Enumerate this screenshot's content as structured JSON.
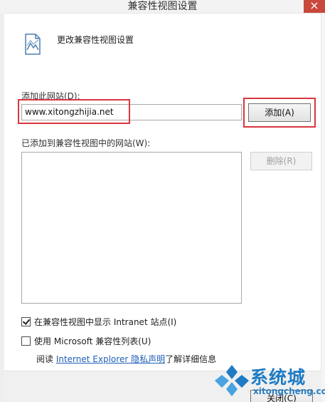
{
  "window": {
    "title": "兼容性视图设置",
    "close_glyph": "×"
  },
  "header": {
    "icon": "compatibility-page-icon",
    "text": "更改兼容性视图设置"
  },
  "add_site": {
    "label": "添加此网站(D):",
    "value": "www.xitongzhijia.net",
    "button_label": "添加(A)"
  },
  "added_sites": {
    "label": "已添加到兼容性视图中的网站(W):",
    "items": [],
    "remove_label": "删除(R)"
  },
  "options": {
    "intranet_label": "在兼容性视图中显示 Intranet 站点(I)",
    "intranet_checked": true,
    "mslist_label": "使用 Microsoft 兼容性列表(U)",
    "mslist_checked": false
  },
  "privacy": {
    "prefix": "阅读 ",
    "link": "Internet Explorer 隐私声明",
    "suffix": "了解详细信息"
  },
  "footer": {
    "close_label": "关闭(C)"
  },
  "watermark": {
    "text": "系统城",
    "subtext": "xitongcheng.com"
  },
  "colors": {
    "highlight": "#d9363e",
    "link": "#1f5fb8",
    "brand_blue": "#1e7bc4"
  }
}
